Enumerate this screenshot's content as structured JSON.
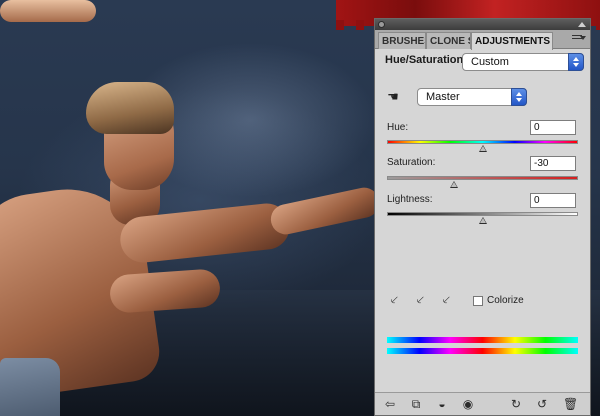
{
  "panel": {
    "tabs": [
      {
        "label": "BRUSHES"
      },
      {
        "label": "CLONE S"
      },
      {
        "label": "ADJUSTMENTS"
      }
    ],
    "title": "Hue/Saturation",
    "preset": "Custom",
    "channel": "Master",
    "hue": {
      "label": "Hue:",
      "value": "0",
      "level": 0.5
    },
    "saturation": {
      "label": "Saturation:",
      "value": "-30",
      "level": 0.35
    },
    "lightness": {
      "label": "Lightness:",
      "value": "0",
      "level": 0.5
    },
    "colorize": {
      "label": "Colorize",
      "checked": false
    }
  },
  "icons": {
    "hand_tool": "hand-adjust-icon",
    "eyedroppers": [
      "eyedropper-icon",
      "eyedropper-plus-icon",
      "eyedropper-minus-icon"
    ],
    "bottom": [
      "back-arrow-icon",
      "expand-view-icon",
      "clip-layer-icon",
      "eye-icon",
      "view-previous-icon",
      "reset-icon",
      "trash-icon"
    ]
  },
  "colors": {
    "panel_bg": "#d6d6d6",
    "accent_blue": "#2356c7"
  }
}
